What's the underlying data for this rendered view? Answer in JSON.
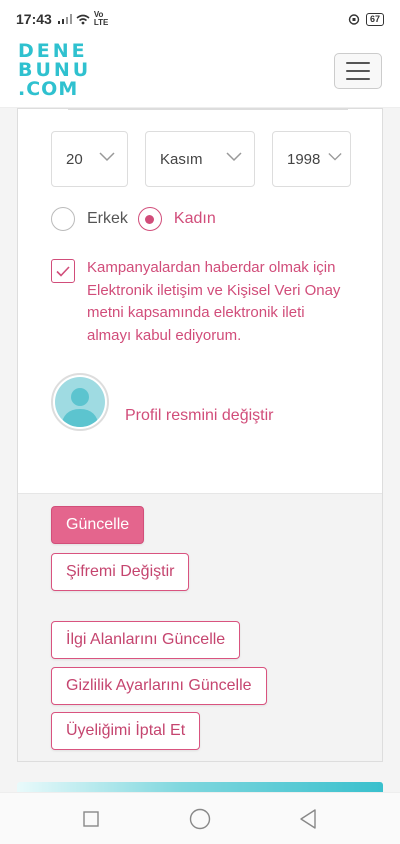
{
  "status_bar": {
    "time": "17:43",
    "network": "Vo LTE",
    "battery": "67"
  },
  "header": {
    "logo_line1": "DENE",
    "logo_line2": "BUNU",
    "logo_line3": ".COM"
  },
  "birth_date": {
    "day": "20",
    "month": "Kasım",
    "year": "1998"
  },
  "gender": {
    "male_label": "Erkek",
    "female_label": "Kadın",
    "selected": "female"
  },
  "consent": {
    "checked": true,
    "text": "Kampanyalardan haberdar olmak için Elektronik iletişim ve Kişisel Veri Onay metni kapsamında elektronik ileti almayı kabul ediyorum."
  },
  "profile": {
    "change_picture_label": "Profil resmini değiştir"
  },
  "actions": {
    "update_label": "Güncelle",
    "change_password_label": "Şifremi Değiştir",
    "update_interests_label": "İlgi Alanlarını Güncelle",
    "update_privacy_label": "Gizlilik Ayarlarını Güncelle",
    "cancel_membership_label": "Üyeliğimi İptal Et"
  },
  "colors": {
    "brand_teal": "#2fc1cf",
    "accent_pink": "#d14d7a",
    "primary_button": "#e4658d"
  }
}
